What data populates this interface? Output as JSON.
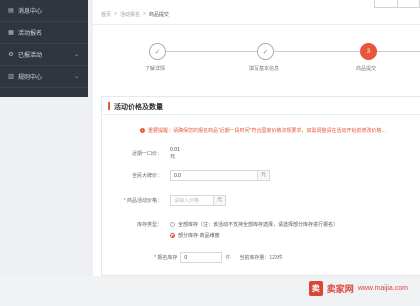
{
  "sidebar": {
    "items": [
      {
        "label": "消息中心",
        "icon": "bell-icon",
        "glyph": "▤"
      },
      {
        "label": "活动报名",
        "icon": "calendar-icon",
        "glyph": "▦"
      },
      {
        "label": "已报活动",
        "icon": "gear-icon",
        "glyph": "⚙",
        "chevron": "⌄"
      },
      {
        "label": "规则中心",
        "icon": "document-icon",
        "glyph": "▥",
        "chevron": "⌄"
      }
    ]
  },
  "breadcrumb": {
    "items": [
      "首页",
      "活动报名",
      "商品提交"
    ],
    "separator": ">"
  },
  "steps": [
    {
      "label": "了解详情",
      "state": "done",
      "glyph": "✓"
    },
    {
      "label": "填写基本信息",
      "state": "done",
      "glyph": "✓"
    },
    {
      "label": "商品提交",
      "state": "active",
      "glyph": "3"
    }
  ],
  "section": {
    "title": "活动价格及数量",
    "notice": "重要提醒：请确保您的报名商品“近期一段时间”符合国家价格法规要求，如需调整请在活动开始前修改价格…"
  },
  "form": {
    "recent_price_label": "近期一口价：",
    "recent_price_value": "0.01元",
    "platform_price_label": "全民大牌价：",
    "platform_price_value": "0.0",
    "platform_price_unit": "元",
    "activity_price_label": "商品活动价格：",
    "activity_price_placeholder": "请输入价格",
    "activity_price_unit": "元",
    "stock_type_label": "库存类型：",
    "stock_options": [
      {
        "label": "全部库存（注：该活动不支持全部库存选择，请选择部分库存进行报名）",
        "selected": false
      },
      {
        "label": "部分库存·商品维度",
        "selected": true
      }
    ],
    "stock_qty_label": "* 报名库存",
    "stock_qty_value": "0",
    "stock_qty_unit": "件",
    "current_stock": "当前库存量：123件"
  },
  "watermark": {
    "logo": "卖",
    "name": "卖家网",
    "url": "www.maijia.com"
  },
  "colors": {
    "accent": "#e8563a",
    "sidebar_bg": "#2f3640"
  }
}
